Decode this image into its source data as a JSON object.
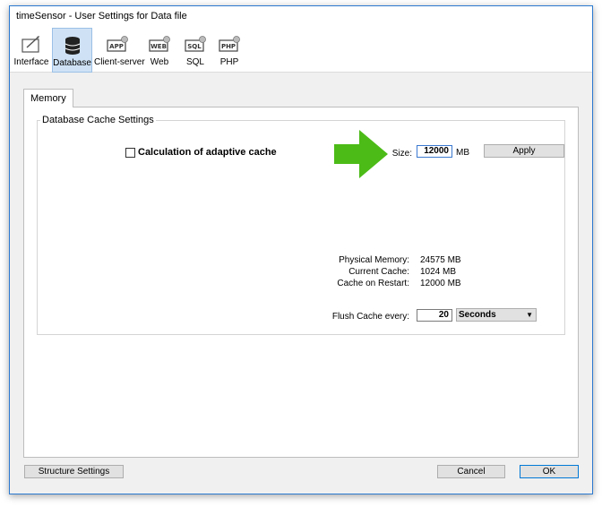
{
  "window": {
    "title": "timeSensor - User Settings for Data file"
  },
  "toolbar": {
    "items": [
      {
        "label": "Interface",
        "icon": "interface-icon",
        "active": false
      },
      {
        "label": "Database",
        "icon": "database-icon",
        "active": true
      },
      {
        "label": "Client-server",
        "icon": "app-icon",
        "badge": "APP",
        "active": false
      },
      {
        "label": "Web",
        "icon": "web-icon",
        "badge": "WEB",
        "active": false
      },
      {
        "label": "SQL",
        "icon": "sql-icon",
        "badge": "SQL",
        "active": false
      },
      {
        "label": "PHP",
        "icon": "php-icon",
        "badge": "PHP",
        "active": false
      }
    ]
  },
  "tabs": {
    "memory": "Memory"
  },
  "cache_group": {
    "title": "Database Cache Settings",
    "adaptive_checkbox_label": "Calculation of adaptive cache",
    "adaptive_checked": false,
    "size_label": "Size:",
    "size_value": "12000",
    "size_unit": "MB",
    "apply_label": "Apply",
    "physical_memory_label": "Physical Memory:",
    "physical_memory_value": "24575  MB",
    "current_cache_label": "Current Cache:",
    "current_cache_value": "1024  MB",
    "cache_restart_label": "Cache on Restart:",
    "cache_restart_value": "12000  MB",
    "flush_label": "Flush Cache every:",
    "flush_value": "20",
    "flush_unit": "Seconds",
    "arrow_color": "#4cbb17"
  },
  "footer": {
    "structure_settings_label": "Structure Settings",
    "cancel_label": "Cancel",
    "ok_label": "OK"
  }
}
